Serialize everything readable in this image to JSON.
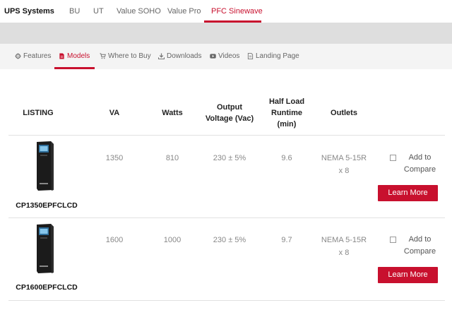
{
  "header": {
    "brand": "UPS Systems",
    "tabs": [
      "BU",
      "UT",
      "Value SOHO",
      "Value Pro",
      "PFC Sinewave"
    ],
    "active_tab": "PFC Sinewave"
  },
  "subnav": {
    "items": [
      {
        "label": "Features",
        "icon": "gear-icon"
      },
      {
        "label": "Models",
        "icon": "document-icon"
      },
      {
        "label": "Where to Buy",
        "icon": "cart-icon"
      },
      {
        "label": "Downloads",
        "icon": "download-icon"
      },
      {
        "label": "Videos",
        "icon": "video-icon"
      },
      {
        "label": "Landing Page",
        "icon": "page-icon"
      }
    ],
    "active_item": "Models"
  },
  "table": {
    "headers": {
      "listing": "LISTING",
      "va": "VA",
      "watts": "Watts",
      "output": [
        "Output",
        "Voltage (Vac)"
      ],
      "runtime": [
        "Half Load",
        "Runtime",
        "(min)"
      ],
      "outlets": "Outlets"
    },
    "rows": [
      {
        "model": "CP1350EPFCLCD",
        "va": "1350",
        "watts": "810",
        "voltage": "230 ± 5%",
        "runtime": "9.6",
        "outlets": [
          "NEMA 5-15R",
          "x 8"
        ],
        "compare_label": [
          "Add to",
          "Compare"
        ],
        "learn_label": "Learn More"
      },
      {
        "model": "CP1600EPFCLCD",
        "va": "1600",
        "watts": "1000",
        "voltage": "230 ± 5%",
        "runtime": "9.7",
        "outlets": [
          "NEMA 5-15R",
          "x 8"
        ],
        "compare_label": [
          "Add to",
          "Compare"
        ],
        "learn_label": "Learn More"
      }
    ]
  },
  "colors": {
    "accent": "#c8102e",
    "band": "#dedede",
    "subnav_bg": "#f4f4f4"
  }
}
